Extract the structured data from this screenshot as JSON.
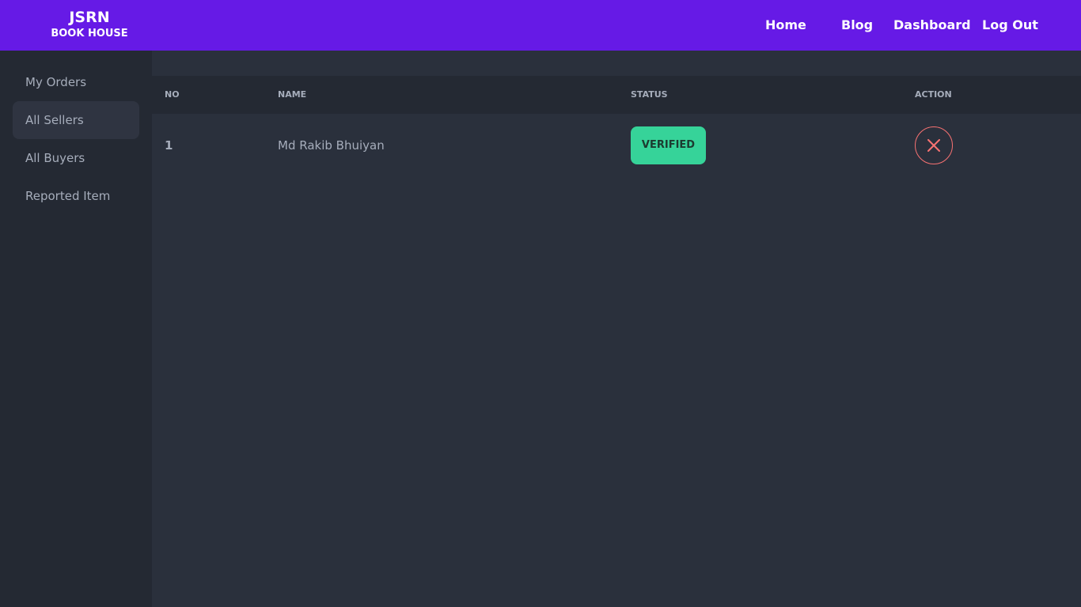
{
  "brand": {
    "title": "JSRN",
    "subtitle": "BOOK HOUSE"
  },
  "nav": {
    "home": "Home",
    "blog": "Blog",
    "dashboard": "Dashboard",
    "logout": "Log Out"
  },
  "sidebar": {
    "items": [
      {
        "label": "My Orders"
      },
      {
        "label": "All Sellers",
        "active": true
      },
      {
        "label": "All Buyers"
      },
      {
        "label": "Reported Item"
      }
    ]
  },
  "table": {
    "headers": {
      "no": "NO",
      "name": "NAME",
      "status": "STATUS",
      "action": "ACTION"
    },
    "rows": [
      {
        "no": "1",
        "name": "Md Rakib Bhuiyan",
        "status": "VERIFIED",
        "action_icon": "close-icon"
      }
    ]
  },
  "colors": {
    "navbar": "#661ae6",
    "sidebar": "#242933",
    "main": "#2a303c",
    "verified_badge": "#36d399",
    "delete_action": "#f87272"
  }
}
